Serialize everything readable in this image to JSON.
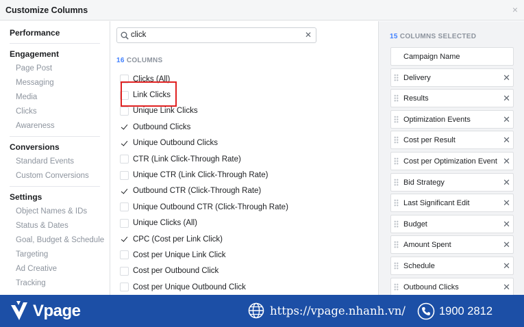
{
  "dialog": {
    "title": "Customize Columns",
    "close_glyph": "×"
  },
  "sidebar": {
    "groups": [
      {
        "heading": "Performance",
        "items": []
      },
      {
        "heading": "Engagement",
        "items": [
          "Page Post",
          "Messaging",
          "Media",
          "Clicks",
          "Awareness"
        ]
      },
      {
        "heading": "Conversions",
        "items": [
          "Standard Events",
          "Custom Conversions"
        ]
      },
      {
        "heading": "Settings",
        "items": [
          "Object Names & IDs",
          "Status & Dates",
          "Goal, Budget & Schedule",
          "Targeting",
          "Ad Creative",
          "Tracking"
        ]
      }
    ]
  },
  "search": {
    "value": "click",
    "clear_glyph": "✕",
    "icon": "search-icon"
  },
  "columns": {
    "count": "16",
    "count_label": "COLUMNS",
    "items": [
      {
        "label": "Clicks (All)",
        "checked": false
      },
      {
        "label": "Link Clicks",
        "checked": false
      },
      {
        "label": "Unique Link Clicks",
        "checked": false
      },
      {
        "label": "Outbound Clicks",
        "checked": true
      },
      {
        "label": "Unique Outbound Clicks",
        "checked": true
      },
      {
        "label": "CTR (Link Click-Through Rate)",
        "checked": false
      },
      {
        "label": "Unique CTR (Link Click-Through Rate)",
        "checked": false
      },
      {
        "label": "Outbound CTR (Click-Through Rate)",
        "checked": true
      },
      {
        "label": "Unique Outbound CTR (Click-Through Rate)",
        "checked": false
      },
      {
        "label": "Unique Clicks (All)",
        "checked": false
      },
      {
        "label": "CPC (Cost per Link Click)",
        "checked": true
      },
      {
        "label": "Cost per Unique Link Click",
        "checked": false
      },
      {
        "label": "Cost per Outbound Click",
        "checked": false
      },
      {
        "label": "Cost per Unique Outbound Click",
        "checked": false
      }
    ]
  },
  "selected": {
    "count": "15",
    "count_label": "COLUMNS SELECTED",
    "items": [
      {
        "label": "Campaign Name",
        "fixed": true
      },
      {
        "label": "Delivery",
        "fixed": false
      },
      {
        "label": "Results",
        "fixed": false
      },
      {
        "label": "Optimization Events",
        "fixed": false
      },
      {
        "label": "Cost per Result",
        "fixed": false
      },
      {
        "label": "Cost per Optimization Event",
        "fixed": false
      },
      {
        "label": "Bid Strategy",
        "fixed": false
      },
      {
        "label": "Last Significant Edit",
        "fixed": false
      },
      {
        "label": "Budget",
        "fixed": false
      },
      {
        "label": "Amount Spent",
        "fixed": false
      },
      {
        "label": "Schedule",
        "fixed": false
      },
      {
        "label": "Outbound Clicks",
        "fixed": false
      }
    ],
    "remove_glyph": "✕"
  },
  "footer": {
    "brand": "Vpage",
    "website": "https://vpage.nhanh.vn/",
    "phone": "1900 2812",
    "colors": {
      "banner": "#1c4fa6",
      "highlight": "#e02020",
      "accent": "#4080ff"
    }
  }
}
